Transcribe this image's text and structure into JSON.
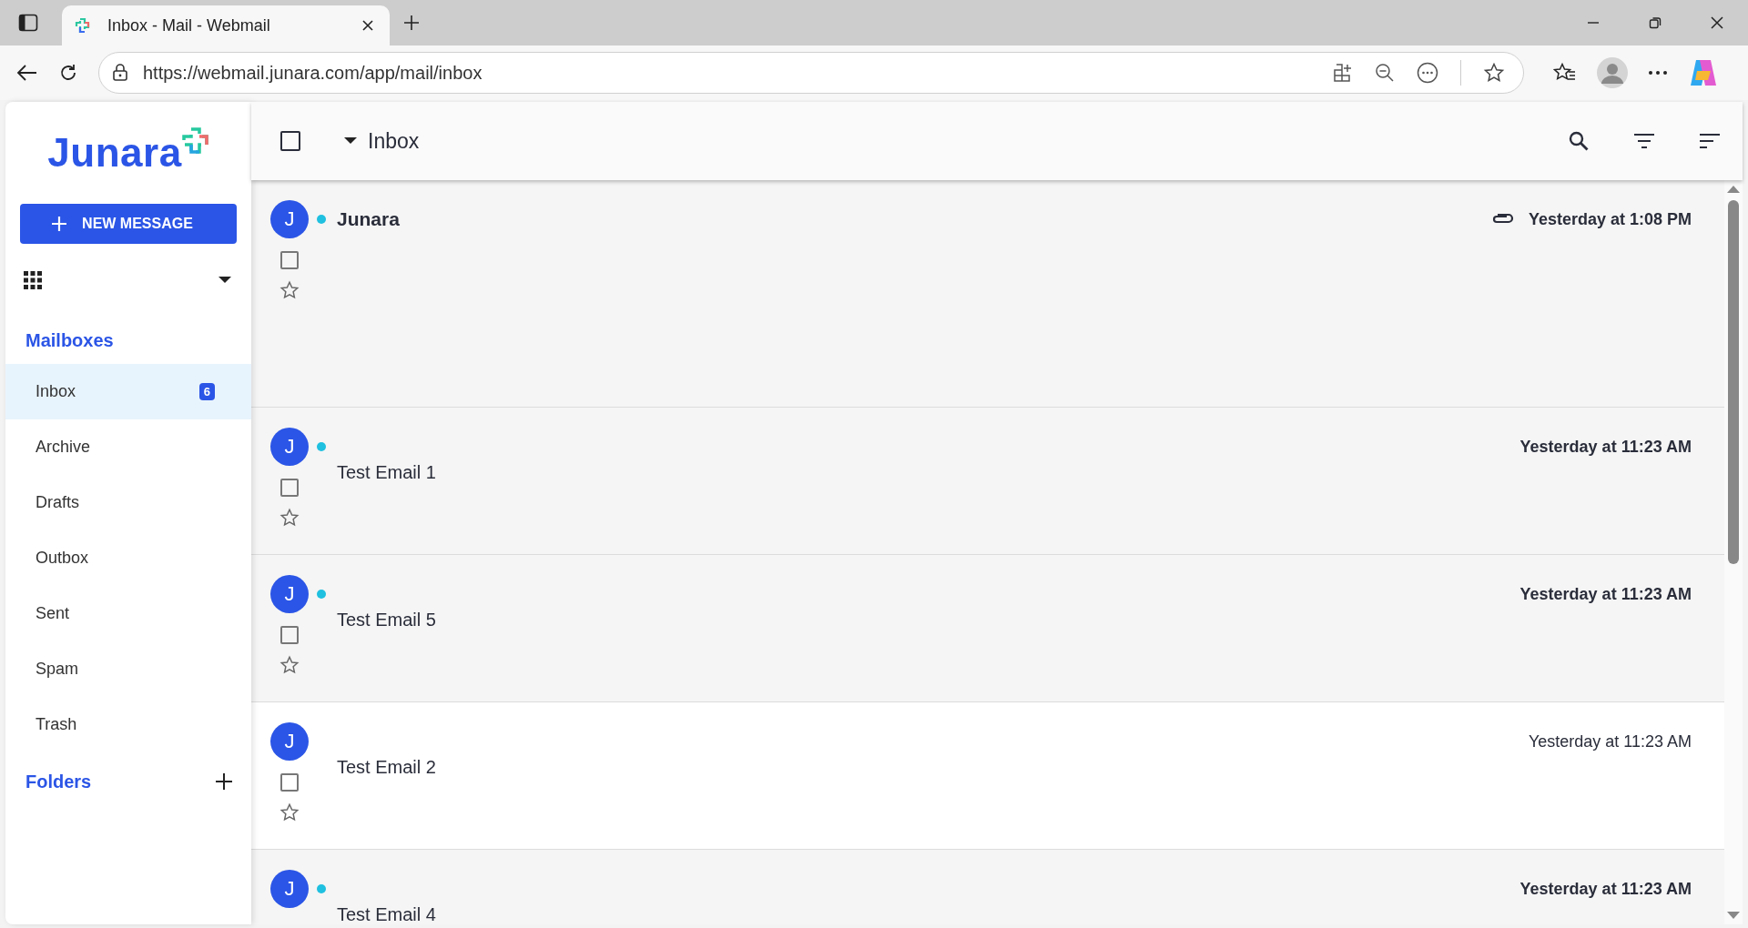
{
  "browser": {
    "tab_title": "Inbox - Mail - Webmail",
    "url": "https://webmail.junara.com/app/mail/inbox"
  },
  "sidebar": {
    "logo": "Junara",
    "new_message": "NEW MESSAGE",
    "mailboxes_heading": "Mailboxes",
    "mailboxes": [
      {
        "label": "Inbox",
        "badge": "6",
        "selected": true
      },
      {
        "label": "Archive",
        "selected": false
      },
      {
        "label": "Drafts",
        "selected": false
      },
      {
        "label": "Outbox",
        "selected": false
      },
      {
        "label": "Sent",
        "selected": false
      },
      {
        "label": "Spam",
        "selected": false
      },
      {
        "label": "Trash",
        "selected": false
      }
    ],
    "folders_heading": "Folders"
  },
  "header": {
    "title": "Inbox",
    "select_all_checked": false
  },
  "messages": [
    {
      "avatar": "J",
      "unread": true,
      "sender": "Junara",
      "date": "Yesterday at 1:08 PM",
      "attachment": true,
      "checked": false,
      "starred": false
    },
    {
      "avatar": "J",
      "unread": true,
      "subject": "Test Email 1",
      "date": "Yesterday at 11:23 AM",
      "attachment": false,
      "checked": false,
      "starred": false
    },
    {
      "avatar": "J",
      "unread": true,
      "subject": "Test Email 5",
      "date": "Yesterday at 11:23 AM",
      "attachment": false,
      "checked": false,
      "starred": false
    },
    {
      "avatar": "J",
      "unread": false,
      "subject": "Test Email 2",
      "date": "Yesterday at 11:23 AM",
      "attachment": false,
      "checked": false,
      "starred": false
    },
    {
      "avatar": "J",
      "unread": true,
      "subject": "Test Email 4",
      "date": "Yesterday at 11:23 AM",
      "attachment": false
    }
  ]
}
